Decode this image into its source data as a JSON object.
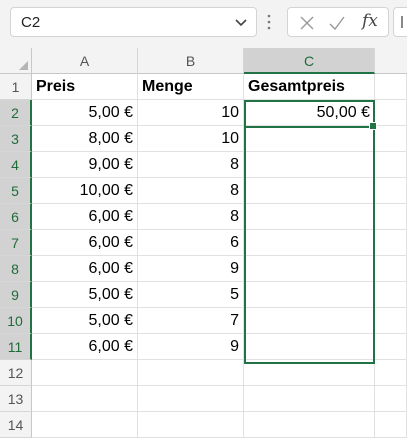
{
  "name_box": {
    "value": "C2"
  },
  "formula_bar": {
    "fx_label": "fx"
  },
  "icons": {
    "name_box_dropdown": "chevron-down-icon",
    "more": "vertical-dots-icon",
    "cancel": "close-icon",
    "enter": "checkmark-icon",
    "function": "fx-icon"
  },
  "colors": {
    "accent": "#217346",
    "header_bg": "#f3f3f3",
    "selected_header_bg": "#d2d2d2"
  },
  "columns": [
    "A",
    "B",
    "C"
  ],
  "rows": [
    "1",
    "2",
    "3",
    "4",
    "5",
    "6",
    "7",
    "8",
    "9",
    "10",
    "11",
    "12",
    "13",
    "14"
  ],
  "selection": {
    "active_cell": "C2",
    "range": "C2:C11"
  },
  "table": {
    "headers": {
      "a": "Preis",
      "b": "Menge",
      "c": "Gesamtpreis"
    },
    "rows": [
      {
        "a": "5,00 €",
        "b": "10",
        "c": "50,00 €"
      },
      {
        "a": "8,00 €",
        "b": "10",
        "c": ""
      },
      {
        "a": "9,00 €",
        "b": "8",
        "c": ""
      },
      {
        "a": "10,00 €",
        "b": "8",
        "c": ""
      },
      {
        "a": "6,00 €",
        "b": "8",
        "c": ""
      },
      {
        "a": "6,00 €",
        "b": "6",
        "c": ""
      },
      {
        "a": "6,00 €",
        "b": "9",
        "c": ""
      },
      {
        "a": "5,00 €",
        "b": "5",
        "c": ""
      },
      {
        "a": "5,00 €",
        "b": "7",
        "c": ""
      },
      {
        "a": "6,00 €",
        "b": "9",
        "c": ""
      }
    ]
  }
}
